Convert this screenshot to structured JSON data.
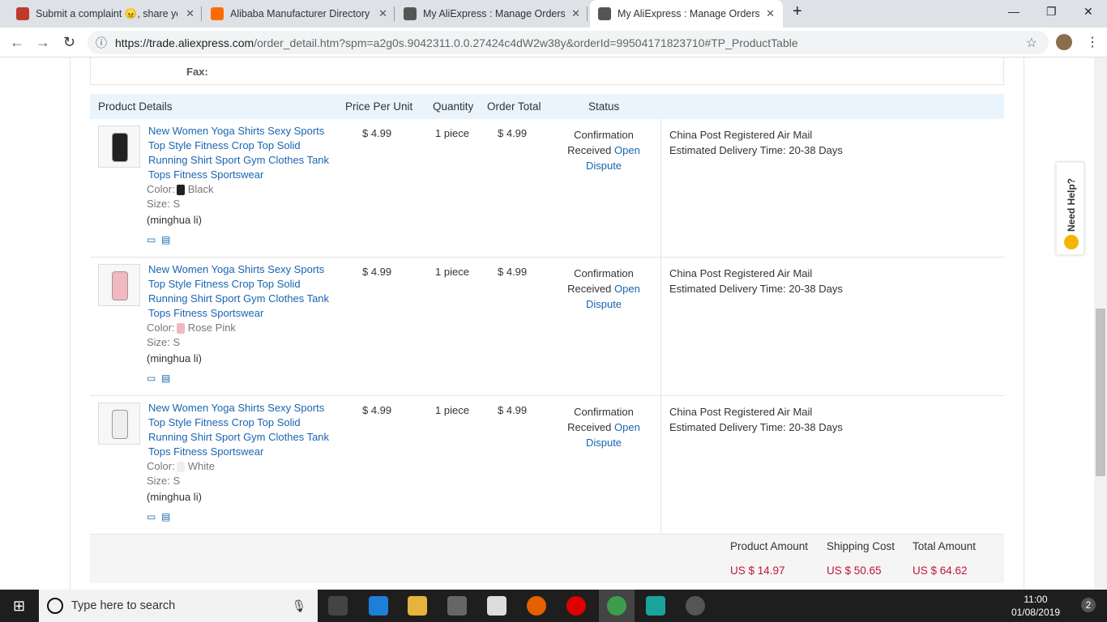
{
  "browser": {
    "tabs": [
      {
        "title": "Submit a complaint 😠, share yo",
        "color": "#c0392b"
      },
      {
        "title": "Alibaba Manufacturer Directory -",
        "color": "#ff6a00"
      },
      {
        "title": "My AliExpress : Manage Orders",
        "color": "#555555"
      },
      {
        "title": "My AliExpress : Manage Orders",
        "color": "#555555"
      }
    ],
    "new_tab": "+",
    "close": "✕",
    "url_host": "https://trade.aliexpress.com",
    "url_path": "/order_detail.htm?spm=a2g0s.9042311.0.0.27424c4dW2w38y&orderId=99504171823710#TP_ProductTable"
  },
  "fax_label": "Fax:",
  "table": {
    "headers": [
      "Product Details",
      "Price Per Unit",
      "Quantity",
      "Order Total",
      "Status"
    ],
    "rows": [
      {
        "title": "New Women Yoga Shirts Sexy Sports Top Style Fitness Crop Top Solid Running Shirt Sport Gym Clothes Tank Tops Fitness Sportswear",
        "color_label": "Color:",
        "color": "Black",
        "swatch": "#222222",
        "size": "Size: S",
        "buyer": "(minghua li)",
        "price": "$ 4.99",
        "qty": "1 piece",
        "total": "$ 4.99",
        "status": "Confirmation Received",
        "open": "Open",
        "dispute": "Dispute",
        "ship": "China Post Registered Air Mail",
        "eta": "Estimated Delivery Time:  20-38 Days"
      },
      {
        "title": "New Women Yoga Shirts Sexy Sports Top Style Fitness Crop Top Solid Running Shirt Sport Gym Clothes Tank Tops Fitness Sportswear",
        "color_label": "Color:",
        "color": "Rose Pink",
        "swatch": "#f2b8c0",
        "size": "Size: S",
        "buyer": "(minghua li)",
        "price": "$ 4.99",
        "qty": "1 piece",
        "total": "$ 4.99",
        "status": "Confirmation Received",
        "open": "Open",
        "dispute": "Dispute",
        "ship": "China Post Registered Air Mail",
        "eta": "Estimated Delivery Time:  20-38 Days"
      },
      {
        "title": "New Women Yoga Shirts Sexy Sports Top Style Fitness Crop Top Solid Running Shirt Sport Gym Clothes Tank Tops Fitness Sportswear",
        "color_label": "Color:",
        "color": "White",
        "swatch": "#eeeeee",
        "size": "Size: S",
        "buyer": "(minghua li)",
        "price": "$ 4.99",
        "qty": "1 piece",
        "total": "$ 4.99",
        "status": "Confirmation Received",
        "open": "Open",
        "dispute": "Dispute",
        "ship": "China Post Registered Air Mail",
        "eta": "Estimated Delivery Time:  20-38 Days"
      }
    ]
  },
  "summary": {
    "product_label": "Product Amount",
    "product": "US $ 14.97",
    "shipping_label": "Shipping Cost",
    "shipping": "US $ 50.65",
    "total_label": "Total Amount",
    "total": "US $ 64.62"
  },
  "help": "Need Help?",
  "taskbar": {
    "search": "Type here to search",
    "time": "11:00",
    "date": "01/08/2019",
    "notifications": "2"
  }
}
